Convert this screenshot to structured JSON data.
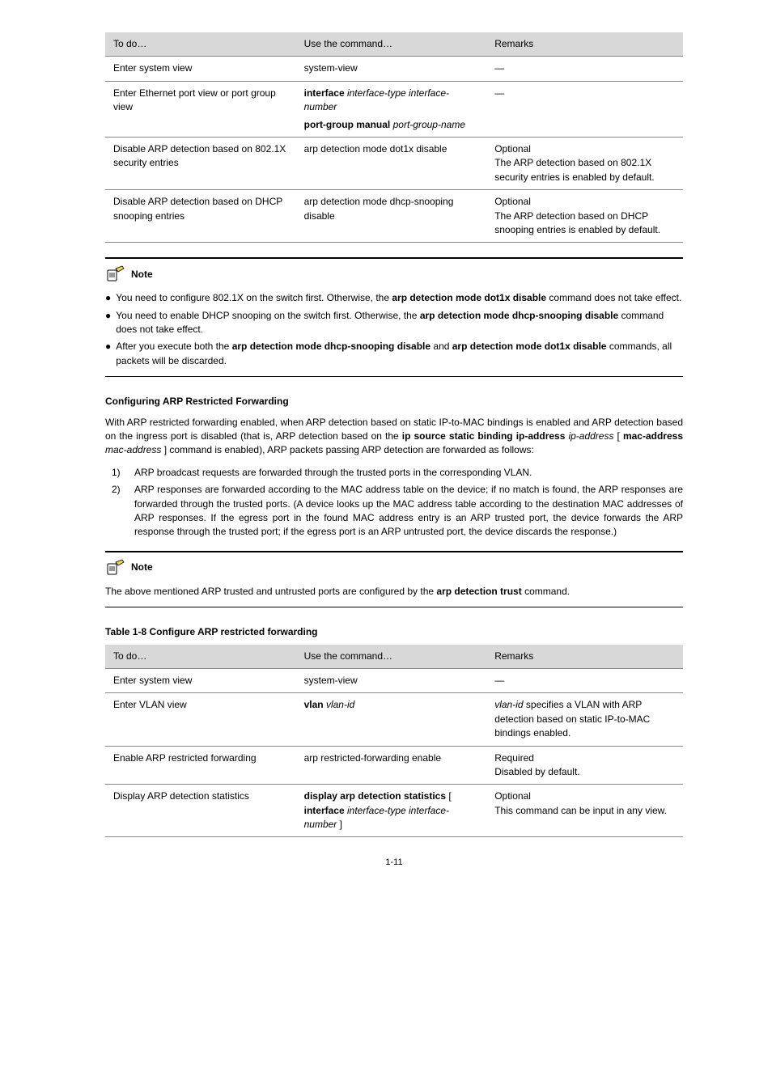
{
  "tableA": {
    "headers": [
      "To do…",
      "Use the command…",
      "Remarks"
    ],
    "rows": [
      {
        "c1": "Enter system view",
        "c2": "system-view",
        "c3": "—"
      },
      {
        "c1_pre": "Enter Ethernet port view or port group view",
        "c2a": "interface ",
        "c2a_arg": "interface-type interface-number",
        "c2b": "port-group manual ",
        "c2b_arg": "port-group-name",
        "c3": "—"
      },
      {
        "c1": "Disable ARP detection based on 802.1X security entries",
        "c2": "arp detection mode dot1x disable",
        "c3": "Optional\nThe ARP detection based on 802.1X security entries is enabled by default."
      },
      {
        "c1": "Disable ARP detection based on DHCP snooping entries",
        "c2": "arp detection mode dhcp-snooping disable",
        "c3": "Optional\nThe ARP detection based on DHCP snooping entries is enabled by default."
      }
    ]
  },
  "note1": {
    "label": "Note",
    "bullets": [
      {
        "pre": "You need to configure 802.1X on the switch first. Otherwise, the ",
        "bold": "arp detection mode dot1x disable",
        "post": " command does not take effect."
      },
      {
        "pre": "You need to enable DHCP snooping on the switch first. Otherwise, the ",
        "bold": "arp detection mode dhcp-snooping disable",
        "post": " command does not take effect."
      },
      {
        "pre": "After you execute both the ",
        "bold1": "arp detection mode dhcp-snooping disable",
        "mid": " and ",
        "bold2": "arp detection mode dot1x disable",
        "post": " commands, all packets will be discarded."
      }
    ]
  },
  "section": {
    "title": "Configuring ARP Restricted Forwarding",
    "p1_pre": "With ARP restricted forwarding enabled, when ARP detection based on static IP-to-MAC bindings is enabled and ARP detection based on the ingress port is disabled (that is, ARP detection based on the ",
    "p1_bold": "ip source static binding ip-address",
    "p1_arg": " ip-address",
    "p1_mid": " [ ",
    "p1_bold2": "mac-address",
    "p1_arg2": " mac-address",
    "p1_post": " ] command is enabled), ARP packets passing ARP detection are forwarded as follows:",
    "items": [
      "ARP broadcast requests are forwarded through the trusted ports in the corresponding VLAN.",
      {
        "pre": "ARP responses are forwarded according to the MAC address table on the device; if no match is found, the ARP responses are forwarded through the trusted ports. (A device looks up the MAC address table according to the destination MAC addresses of ARP responses. If the egress port in the found MAC address entry is an ARP trusted port, the device forwards the ARP response through the trusted port; if the egress port is an ARP untrusted port, the device discards the response.)"
      }
    ]
  },
  "note2": {
    "label": "Note",
    "text": "The above mentioned ARP trusted and untrusted ports are configured by the ",
    "bold": "arp detection trust",
    "post": " command."
  },
  "tableB": {
    "caption": "Table 1-8 Configure ARP restricted forwarding",
    "headers": [
      "To do…",
      "Use the command…",
      "Remarks"
    ],
    "rows": [
      {
        "c1": "Enter system view",
        "c2": "system-view",
        "c3": "—"
      },
      {
        "c1": "Enter VLAN view",
        "c2a": "vlan ",
        "c2a_arg": "vlan-id",
        "c3_pre": "",
        "c3_arg": "vlan-id",
        "c3_post": " specifies a VLAN with ARP detection based on static IP-to-MAC bindings enabled."
      },
      {
        "c1": "Enable ARP restricted forwarding",
        "c2": "arp restricted-forwarding enable",
        "c3": "Required\nDisabled by default."
      },
      {
        "c1": "Display ARP detection statistics",
        "c2a": "display arp detection statistics",
        "c2b_pre": " [ ",
        "c2b_bold": "interface",
        "c2b_ital": " interface-type interface-number",
        "c2b_post": " ]",
        "c3": "Optional\nThis command can be input in any view."
      }
    ]
  },
  "pageNumber": "1-11"
}
